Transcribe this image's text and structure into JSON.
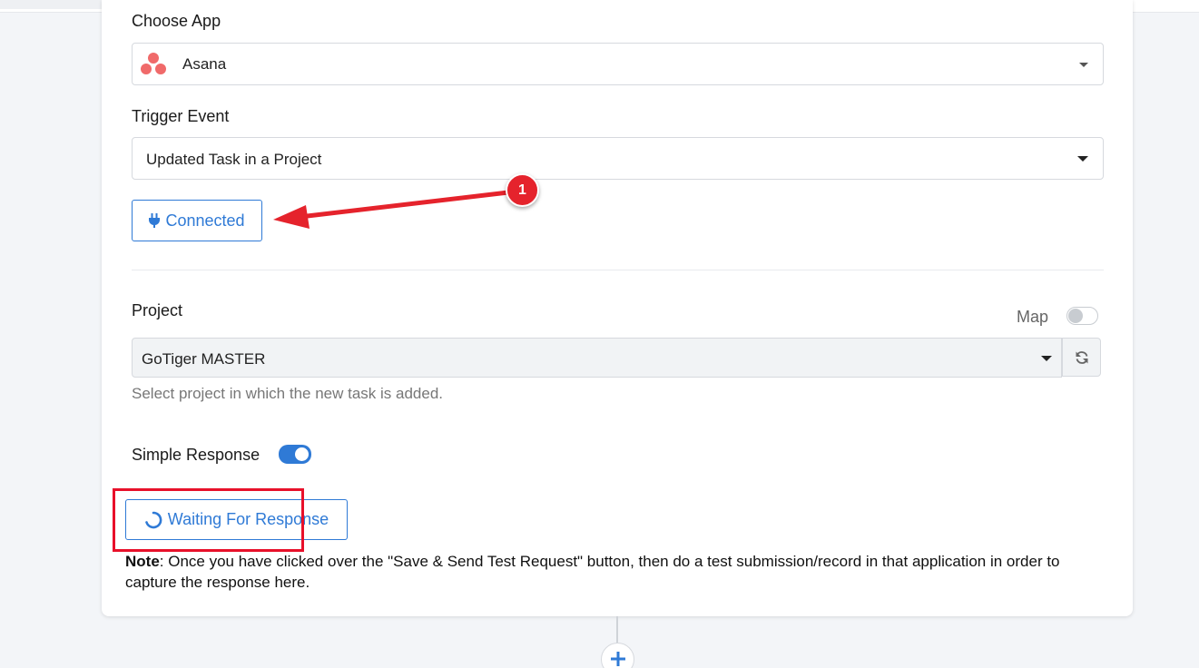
{
  "form": {
    "choose_app_label": "Choose App",
    "app_value": "Asana",
    "trigger_event_label": "Trigger Event",
    "trigger_event_value": "Updated Task in a Project",
    "connected_label": "Connected",
    "project_label": "Project",
    "map_label": "Map",
    "project_value": "GoTiger MASTER",
    "project_help": "Select project in which the new task is added.",
    "simple_response_label": "Simple Response",
    "waiting_label": "Waiting For Response",
    "note_prefix": "Note",
    "note_text": ": Once you have clicked over the \"Save & Send Test Request\" button, then do a test submission/record in that application in order to capture the response here."
  },
  "annotation": {
    "badge_number": "1"
  },
  "toggles": {
    "map_enabled": false,
    "simple_response_enabled": true
  },
  "colors": {
    "accent": "#2f7ad6",
    "asana": "#f06a6a",
    "annotation_red": "#e5232c",
    "highlight_box": "#e8102a"
  },
  "icons": {
    "app": "asana-logo-icon",
    "connected": "plug-icon",
    "refresh": "refresh-icon",
    "waiting": "spinner-icon",
    "add": "plus-icon"
  }
}
